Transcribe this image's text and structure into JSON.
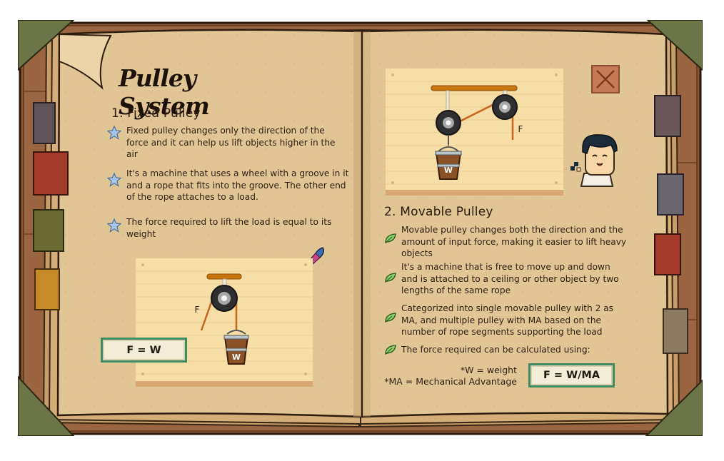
{
  "title": "Pulley System",
  "left": {
    "section_heading": "1. Fixed Pulley",
    "bullets": [
      "Fixed pulley changes only the direction of the force and it can help us lift objects higher in the air",
      "It's a machine that uses a wheel with a groove in it and a rope that fits into the groove. The other end of the rope attaches to a load.",
      "The force required to lift the load is equal to its weight"
    ],
    "diagram": {
      "force_label": "F",
      "load_label": "W"
    },
    "formula": "F = W"
  },
  "right": {
    "section_heading": "2. Movable Pulley",
    "bullets": [
      "Movable pulley changes both the direction and the amount of input force, making it easier to lift heavy objects",
      "It's a machine that is free to move up and down and is attached to a ceiling or other object by two lengths of the same rope",
      "Categorized into single movable pulley with 2 as MA, and multiple pulley with MA based on the number of rope segments supporting the load",
      "The force required can be calculated using:"
    ],
    "diagram": {
      "force_label": "F",
      "load_label": "W"
    },
    "note_w": "*W = weight",
    "note_ma": "*MA = Mechanical Advantage",
    "formula": "F = W/MA"
  },
  "colors": {
    "page": "#e2c696",
    "cover": "#8a5a36",
    "formula_border": "#3f8a5e",
    "rope": "#c8651d",
    "bar": "#c8770f"
  },
  "icons": {
    "left_bullet": "star-icon",
    "right_bullet": "leaf-icon",
    "close": "close-icon",
    "quill": "quill-pen-icon",
    "character": "character-avatar"
  }
}
